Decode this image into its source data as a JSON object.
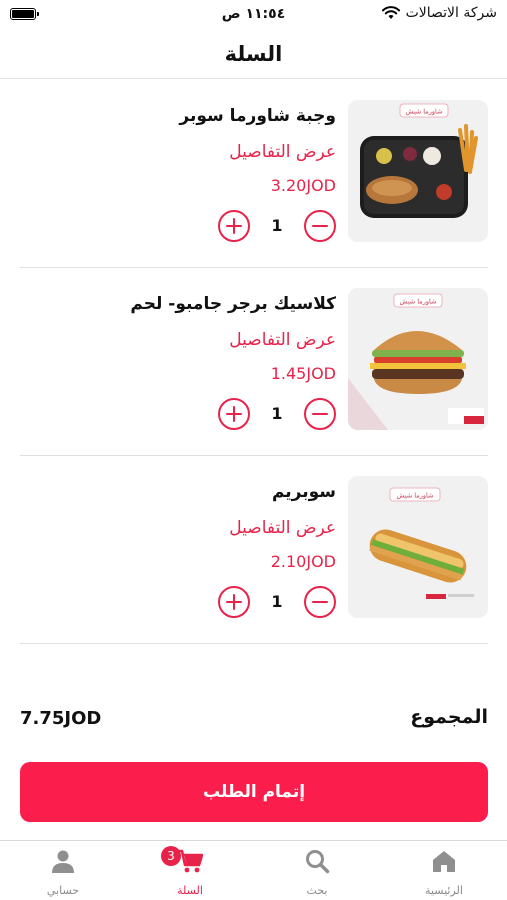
{
  "status_bar": {
    "carrier": "شركة الاتصالات",
    "time": "١١:٥٤ ص"
  },
  "header": {
    "title": "السلة"
  },
  "cart": {
    "items": [
      {
        "name": "وجبة شاورما سوبر",
        "details_label": "عرض التفاصيل",
        "price": "3.20JOD",
        "quantity": "1",
        "image_brand": "شاورما شيش",
        "image_icon": "shawarma-meal-icon"
      },
      {
        "name": "كلاسيك برجر جامبو- لحم",
        "details_label": "عرض التفاصيل",
        "price": "1.45JOD",
        "quantity": "1",
        "image_brand": "شاورما شيش",
        "image_icon": "burger-icon"
      },
      {
        "name": "سوبريم",
        "details_label": "عرض التفاصيل",
        "price": "2.10JOD",
        "quantity": "1",
        "image_brand": "شاورما شيش",
        "image_icon": "sandwich-icon"
      }
    ]
  },
  "summary": {
    "total_label": "المجموع",
    "total_value": "7.75JOD"
  },
  "checkout": {
    "label": "إتمام الطلب"
  },
  "tab_bar": {
    "tabs": [
      {
        "label": "الرئيسية",
        "icon": "home-icon"
      },
      {
        "label": "بحث",
        "icon": "search-icon"
      },
      {
        "label": "السلة",
        "icon": "cart-icon",
        "badge": "3",
        "active": true
      },
      {
        "label": "حسابي",
        "icon": "person-icon"
      }
    ]
  },
  "colors": {
    "accent": "#e8234a",
    "button": "#fb1d4c"
  }
}
